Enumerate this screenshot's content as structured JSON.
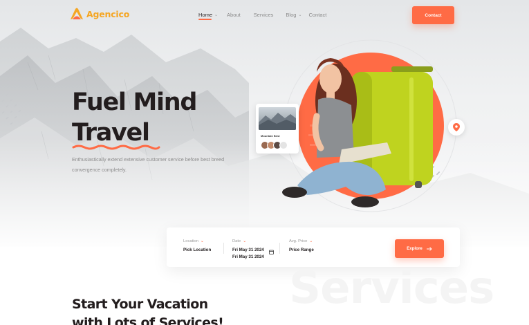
{
  "brand": {
    "name": "Agencico",
    "accent": "#ff6b45",
    "logo_color": "#f5a623"
  },
  "nav": {
    "items": [
      {
        "label": "Home",
        "has_dropdown": true,
        "active": true
      },
      {
        "label": "About",
        "has_dropdown": false,
        "active": false
      },
      {
        "label": "Services",
        "has_dropdown": false,
        "active": false
      },
      {
        "label": "Blog",
        "has_dropdown": true,
        "active": false
      },
      {
        "label": "Contact",
        "has_dropdown": false,
        "active": false
      }
    ],
    "cta_label": "Contact"
  },
  "hero": {
    "headline_line1": "Fuel Mind",
    "headline_line2": "Travel",
    "description": "Enthusiastically extend extensive customer service before best breed convergence completely."
  },
  "mini_card": {
    "title": "Mountain Best"
  },
  "search": {
    "location": {
      "label": "Location",
      "value": "Pick Location"
    },
    "date": {
      "label": "Date",
      "value_from": "Fri May 31 2024",
      "value_to": "Fri May 31 2024"
    },
    "price": {
      "label": "Avg. Price",
      "value": "Price Range"
    },
    "button_label": "Explore"
  },
  "services": {
    "ghost_word": "Services",
    "title_line1": "Start Your Vacation",
    "title_line2": "with Lots of Services!"
  }
}
